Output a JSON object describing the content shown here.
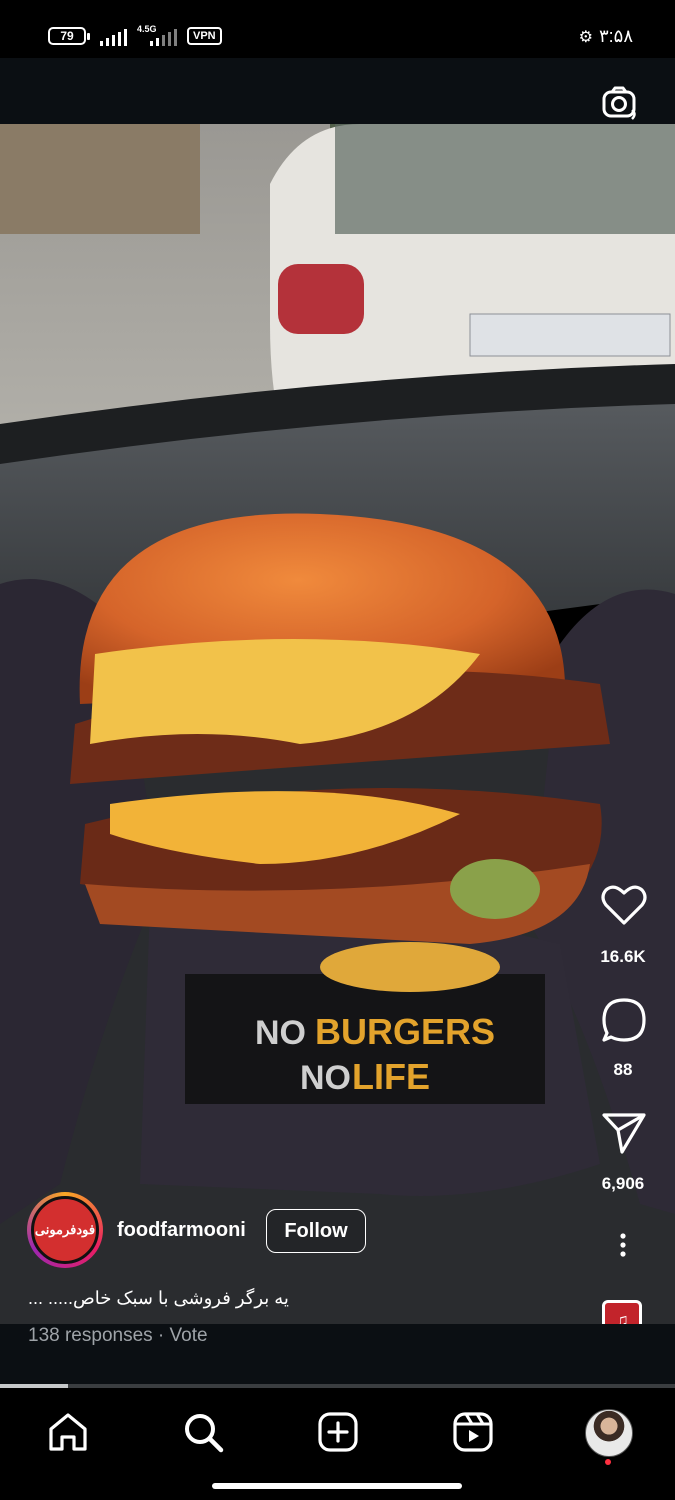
{
  "status_bar": {
    "battery": "79",
    "network": "4.5G",
    "vpn": "VPN",
    "time": "۳:۵۸"
  },
  "post": {
    "username": "foodfarmooni",
    "avatar_text": "فودفرمونی",
    "follow_label": "Follow",
    "caption": "... .....یه برگر فروشی با سبک خاص",
    "responses": "138 responses · Vote",
    "video_progress": 0.1,
    "photo_text": {
      "line1_a": "NO",
      "line1_b": "BURGERS",
      "line2_a": "NO",
      "line2_b": "LIFE"
    }
  },
  "actions": {
    "likes": "16.6K",
    "comments": "88",
    "shares": "6,906"
  },
  "nav": {
    "items": [
      "home-icon",
      "search-icon",
      "create-icon",
      "reels-icon",
      "profile-avatar"
    ]
  },
  "colors": {
    "follow_border": "#ffffff",
    "nav_bg": "#000000",
    "notification_dot": "#ff3040"
  }
}
